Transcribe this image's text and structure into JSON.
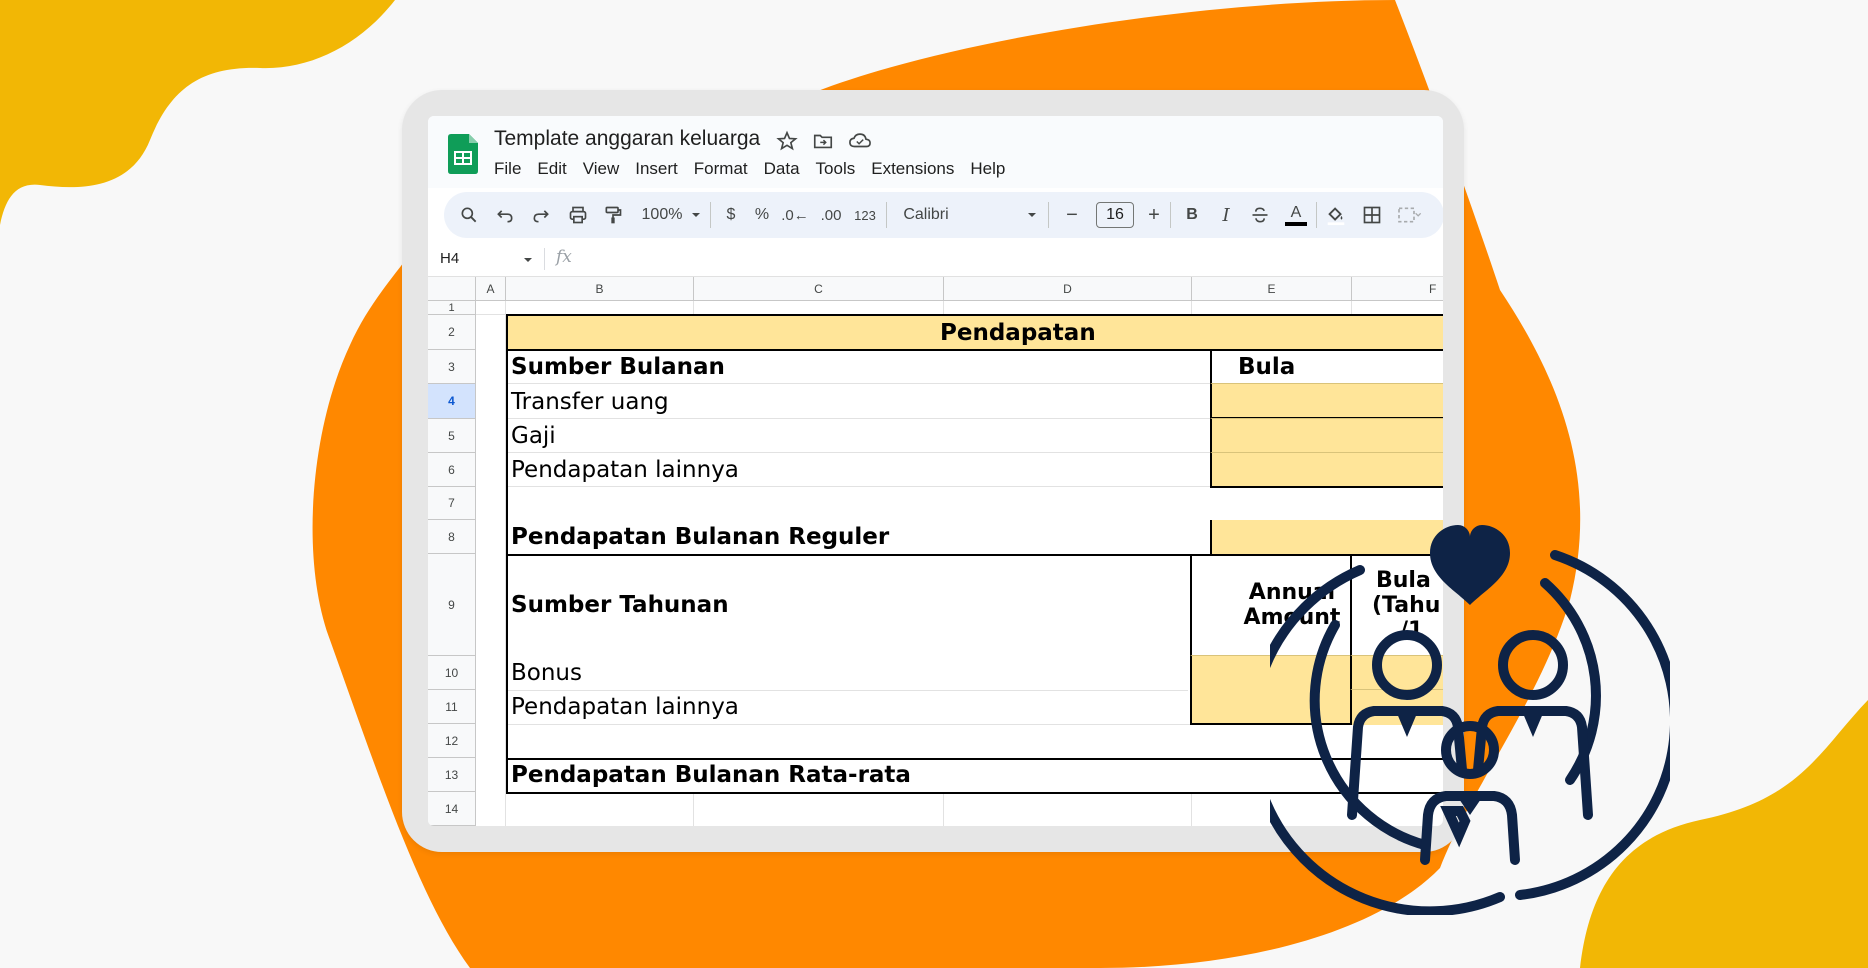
{
  "colors": {
    "background": "#f8f8f8",
    "orange": "#ff8800",
    "yellow": "#f2b705",
    "navy": "#0e2346",
    "cell_yellow": "#ffe599",
    "sheets_green": "#0f9d58"
  },
  "icons": {
    "logo": "google-sheets-logo",
    "star": "star-icon",
    "move": "move-to-folder-icon",
    "cloud": "cloud-saved-icon",
    "overlay": "family-heart-icon"
  },
  "doc": {
    "title": "Template anggaran keluarga"
  },
  "menu": [
    "File",
    "Edit",
    "View",
    "Insert",
    "Format",
    "Data",
    "Tools",
    "Extensions",
    "Help"
  ],
  "toolbar": {
    "zoom": "100%",
    "currency": "$",
    "percent": "%",
    "decimal_decrease": ".0←",
    "decimal_increase": ".00",
    "number_format": "123",
    "font": "Calibri",
    "minus": "−",
    "font_size": "16",
    "plus": "+",
    "bold": "B",
    "italic": "I",
    "underline_text": "A"
  },
  "formula_bar": {
    "cell_ref": "H4",
    "fx": "fx",
    "value": ""
  },
  "columns": [
    "A",
    "B",
    "C",
    "D",
    "E",
    "F"
  ],
  "rows": [
    "1",
    "2",
    "3",
    "4",
    "5",
    "6",
    "7",
    "8",
    "9",
    "10",
    "11",
    "12",
    "13",
    "14"
  ],
  "selected_row": "4",
  "sheet": {
    "header": "Pendapatan",
    "monthly_sources_label": "Sumber Bulanan",
    "monthly_col_header": "Bula",
    "monthly_items": [
      "Transfer uang",
      "Gaji",
      "Pendapatan lainnya"
    ],
    "regular_monthly": "Pendapatan Bulanan Reguler",
    "annual_sources_label": "Sumber Tahunan",
    "annual_amount_header_line1": "Annual",
    "annual_amount_header_line2": "Amount",
    "monthly_annual_header_line1": "Bula",
    "monthly_annual_header_line2": "(Tahu",
    "monthly_annual_header_line3": "/1",
    "annual_items": [
      "Bonus",
      "Pendapatan lainnya"
    ],
    "average_monthly": "Pendapatan Bulanan Rata-rata"
  }
}
